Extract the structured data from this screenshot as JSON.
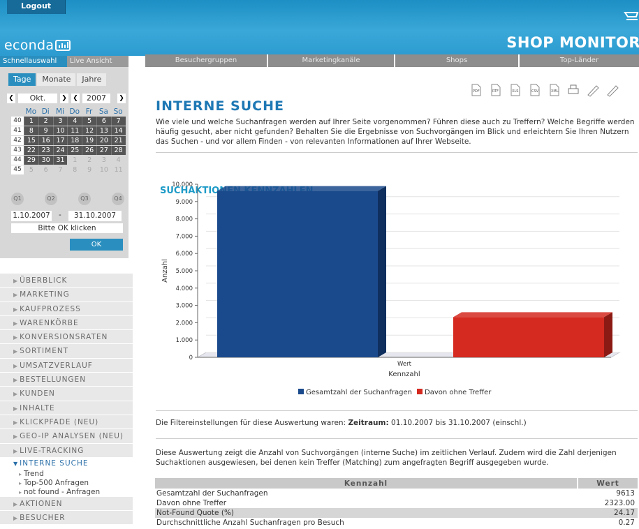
{
  "header": {
    "logout": "Logout",
    "brand": "econda",
    "product": "SHOP MONITOR",
    "colors": {
      "bar": "#2c9bd0",
      "accent": "#2a8fbf"
    }
  },
  "side_tabs": {
    "quick": "Schnellauswahl",
    "live": "Live Ansicht"
  },
  "topnav": [
    "Besuchergruppen",
    "Marketingkanäle",
    "Shops",
    "Top-Länder"
  ],
  "period": {
    "tabs": [
      "Tage",
      "Monate",
      "Jahre"
    ],
    "month": "Okt.",
    "year": "2007",
    "weekdays": [
      "Mo",
      "Di",
      "Mi",
      "Do",
      "Fr",
      "Sa",
      "So"
    ],
    "weeks": [
      {
        "wk": "40",
        "days": [
          "1",
          "2",
          "3",
          "4",
          "5",
          "6",
          "7"
        ],
        "off": []
      },
      {
        "wk": "41",
        "days": [
          "8",
          "9",
          "10",
          "11",
          "12",
          "13",
          "14"
        ],
        "off": []
      },
      {
        "wk": "42",
        "days": [
          "15",
          "16",
          "17",
          "18",
          "19",
          "20",
          "21"
        ],
        "off": []
      },
      {
        "wk": "43",
        "days": [
          "22",
          "23",
          "24",
          "25",
          "26",
          "27",
          "28"
        ],
        "off": []
      },
      {
        "wk": "44",
        "days": [
          "29",
          "30",
          "31",
          "1",
          "2",
          "3",
          "4"
        ],
        "off": [
          3,
          4,
          5,
          6
        ]
      },
      {
        "wk": "45",
        "days": [
          "5",
          "6",
          "7",
          "8",
          "9",
          "10",
          "11"
        ],
        "off": [
          0,
          1,
          2,
          3,
          4,
          5,
          6
        ]
      }
    ],
    "quarters": [
      "Q1",
      "Q2",
      "Q3",
      "Q4"
    ],
    "from": "1.10.2007",
    "sep": "-",
    "to": "31.10.2007",
    "hint": "Bitte OK klicken",
    "ok": "OK"
  },
  "menu": {
    "items_before": [
      "ÜBERBLICK",
      "MARKETING",
      "KAUFPROZESS",
      "WARENKÖRBE",
      "KONVERSIONSRATEN",
      "SORTIMENT",
      "UMSATZVERLAUF",
      "BESTELLUNGEN",
      "KUNDEN",
      "INHALTE",
      "KLICKPFADE (NEU)",
      "GEO-IP ANALYSEN (NEU)",
      "LIVE-TRACKING"
    ],
    "open": "INTERNE SUCHE",
    "sub": [
      "Trend",
      "Top-500 Anfragen",
      "not found - Anfragen"
    ],
    "items_after": [
      "AKTIONEN",
      "BESUCHER"
    ]
  },
  "toolbar": [
    "PDF",
    "RTF",
    "XLS",
    "CSV",
    "XML",
    "print",
    "edit",
    "pen"
  ],
  "main": {
    "title": "INTERNE SUCHE",
    "intro": "Wie viele und welche Suchanfragen werden auf Ihrer Seite vorgenommen? Führen diese auch zu Treffern? Welche Begriffe werden häufig gesucht, aber nicht gefunden? Behalten Sie die Ergebnisse von Suchvorgängen im Blick und erleichtern Sie Ihren Nutzern das Suchen - und vor allem Finden - von relevanten Informationen auf Ihrer Webseite.",
    "section_title": "SUCHAKTIONEN KENNZAHLEN",
    "filter_prefix": "Die Filtereinstellungen für diese Auswertung waren: ",
    "filter_label": "Zeitraum:",
    "filter_value": " 01.10.2007 bis 31.10.2007 (einschl.)",
    "description": "Diese Auswertung zeigt die Anzahl von Suchvorgängen (interne Suche) im zeitlichen Verlauf. Zudem wird die Zahl derjenigen Suchaktionen ausgewiesen, bei denen kein Treffer (Matching) zum angefragten Begriff ausgegeben wurde."
  },
  "chart_data": {
    "type": "bar",
    "categories": [
      "Wert"
    ],
    "series": [
      {
        "name": "Gesamtzahl der Suchanfragen",
        "values": [
          9613
        ],
        "color": "#1b4a8c"
      },
      {
        "name": "Davon ohne Treffer",
        "values": [
          2323
        ],
        "color": "#d42a20"
      }
    ],
    "xlabel": "Kennzahl",
    "ylabel": "Anzahl",
    "ylim": [
      0,
      10000
    ],
    "yticks": [
      "0",
      "1.000",
      "2.000",
      "3.000",
      "4.000",
      "5.000",
      "6.000",
      "7.000",
      "8.000",
      "9.000",
      "10.000"
    ],
    "grid": true,
    "legend": "bottom"
  },
  "table": {
    "headers": [
      "Kennzahl",
      "Wert"
    ],
    "rows": [
      [
        "Gesamtzahl der Suchanfragen",
        "9613"
      ],
      [
        "Davon ohne Treffer",
        "2323.00"
      ],
      [
        "Not-Found Quote (%)",
        "24.17"
      ],
      [
        "Durchschnittliche Anzahl Suchanfragen pro Besuch",
        "0.27"
      ]
    ]
  }
}
